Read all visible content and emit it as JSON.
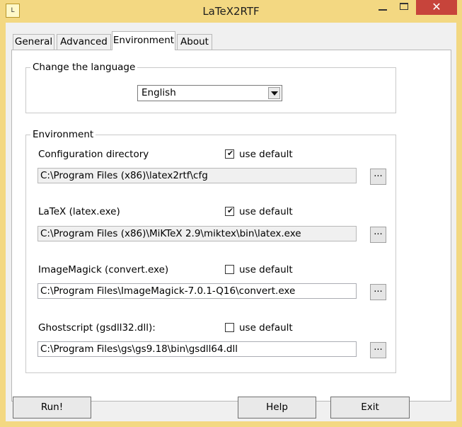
{
  "window": {
    "title": "LaTeX2RTF",
    "app_icon_text": "L",
    "close_symbol": "✕"
  },
  "tabs": [
    {
      "label": "General",
      "active": false
    },
    {
      "label": "Advanced",
      "active": false
    },
    {
      "label": "Environment",
      "active": true
    },
    {
      "label": "About",
      "active": false
    }
  ],
  "language": {
    "group_title": "Change the language",
    "selected": "English"
  },
  "environment": {
    "group_title": "Environment",
    "items": [
      {
        "label": "Configuration directory",
        "use_default_label": "use default",
        "use_default": true,
        "path": "C:\\Program Files (x86)\\latex2rtf\\cfg",
        "browse_label": "..."
      },
      {
        "label": "LaTeX (latex.exe)",
        "use_default_label": "use default",
        "use_default": true,
        "path": "C:\\Program Files (x86)\\MiKTeX 2.9\\miktex\\bin\\latex.exe",
        "browse_label": "..."
      },
      {
        "label": "ImageMagick (convert.exe)",
        "use_default_label": "use default",
        "use_default": false,
        "path": "C:\\Program Files\\ImageMagick-7.0.1-Q16\\convert.exe",
        "browse_label": "..."
      },
      {
        "label": "Ghostscript (gsdll32.dll):",
        "use_default_label": "use default",
        "use_default": false,
        "path": "C:\\Program Files\\gs\\gs9.18\\bin\\gsdll64.dll",
        "browse_label": "..."
      }
    ]
  },
  "buttons": {
    "run": "Run!",
    "help": "Help",
    "exit": "Exit"
  },
  "colors": {
    "titlebar": "#f3d882",
    "close_button": "#c7443b"
  }
}
